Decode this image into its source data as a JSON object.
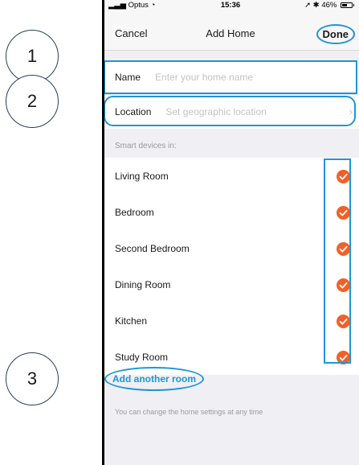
{
  "callouts": [
    "1",
    "2",
    "3"
  ],
  "status_bar": {
    "carrier": "Optus",
    "time": "15:36",
    "battery": "46%"
  },
  "nav": {
    "cancel": "Cancel",
    "title": "Add Home",
    "done": "Done"
  },
  "name_field": {
    "label": "Name",
    "placeholder": "Enter your home name"
  },
  "location_field": {
    "label": "Location",
    "placeholder": "Set geographic location"
  },
  "section_header": "Smart devices in:",
  "rooms": [
    {
      "label": "Living Room",
      "checked": true
    },
    {
      "label": "Bedroom",
      "checked": true
    },
    {
      "label": "Second Bedroom",
      "checked": true
    },
    {
      "label": "Dining Room",
      "checked": true
    },
    {
      "label": "Kitchen",
      "checked": true
    },
    {
      "label": "Study Room",
      "checked": true
    }
  ],
  "add_room": "Add another room",
  "footer_note": "You can change the home settings at any time",
  "colors": {
    "accent": "#1f95d6",
    "check": "#f0612a"
  }
}
